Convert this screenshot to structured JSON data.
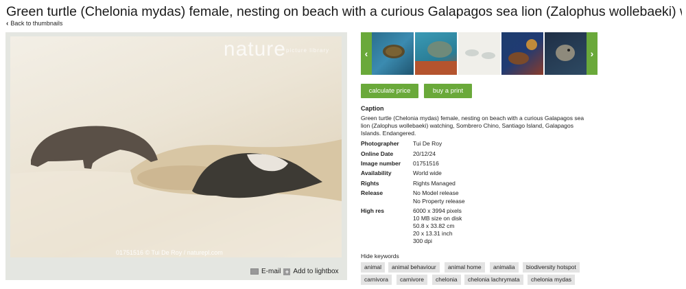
{
  "page_title": "Green turtle (Chelonia mydas) female, nesting on beach with a curious Galapagos sea lion (Zalophus wollebaeki) watching, ...",
  "back_link": "Back to thumbnails",
  "image": {
    "watermark": "nature",
    "watermark_small": "picture library",
    "credit": "01751516 © Tui De Roy / naturepl.com"
  },
  "image_actions": {
    "email": "E-mail",
    "lightbox": "Add to lightbox"
  },
  "buttons": {
    "calculate": "calculate price",
    "buy": "buy a print"
  },
  "caption": {
    "label": "Caption",
    "text": "Green turtle (Chelonia mydas) female, nesting on beach with a curious Galapagos sea lion (Zalophus wollebaeki) watching, Sombrero Chino, Santiago Island, Galapagos Islands. Endangered."
  },
  "details": [
    {
      "key": "Photographer",
      "value": "Tui De Roy"
    },
    {
      "key": "Online Date",
      "value": "20/12/24"
    },
    {
      "key": "Image number",
      "value": "01751516"
    },
    {
      "key": "Availability",
      "value": "World wide"
    },
    {
      "key": "Rights",
      "value": "Rights Managed"
    },
    {
      "key": "Release",
      "value": "No Model release"
    },
    {
      "key": "",
      "value": "No Property release"
    },
    {
      "key": "High res",
      "value": "6000 x 3994  pixels"
    },
    {
      "key": "",
      "value": "10 MB  size on disk"
    },
    {
      "key": "",
      "value": "50.8 x 33.82  cm"
    },
    {
      "key": "",
      "value": "20 x 13.31  inch"
    },
    {
      "key": "",
      "value": "300  dpi"
    }
  ],
  "hide_keywords": "Hide keywords",
  "keywords": [
    "animal",
    "animal behaviour",
    "animal home",
    "animalia",
    "biodiversity hotspot",
    "carnivora",
    "carnivore",
    "chelonia",
    "chelonia lachrymata",
    "chelonia mydas"
  ],
  "colors": {
    "accent": "#6aa93a",
    "keyword_bg": "#e3e3e3"
  }
}
